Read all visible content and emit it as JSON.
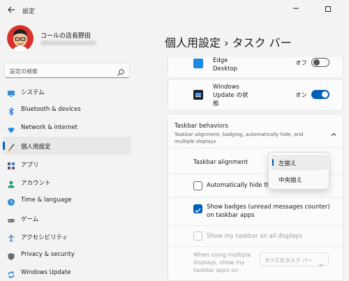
{
  "window": {
    "title": "設定",
    "back_icon": "back-arrow-icon",
    "minimize_icon": "minimize-icon",
    "maximize_icon": "maximize-icon"
  },
  "profile": {
    "name": "コールの店長野田",
    "avatar_icon": "avatar-icon"
  },
  "search": {
    "placeholder": "設定の検索",
    "icon": "search-icon"
  },
  "sidebar": {
    "items": [
      {
        "label": "システム",
        "icon": "monitor-icon",
        "active": false
      },
      {
        "label": "Bluetooth & devices",
        "icon": "bluetooth-icon",
        "active": false
      },
      {
        "label": "Network & internet",
        "icon": "wifi-icon",
        "active": false
      },
      {
        "label": "個人用設定",
        "icon": "brush-icon",
        "active": true
      },
      {
        "label": "アプリ",
        "icon": "apps-icon",
        "active": false
      },
      {
        "label": "アカウント",
        "icon": "person-icon",
        "active": false
      },
      {
        "label": "Time & language",
        "icon": "globe-clock-icon",
        "active": false
      },
      {
        "label": "ゲーム",
        "icon": "gamepad-icon",
        "active": false
      },
      {
        "label": "アクセシビリティ",
        "icon": "accessibility-icon",
        "active": false
      },
      {
        "label": "Privacy & security",
        "icon": "shield-icon",
        "active": false
      },
      {
        "label": "Windows Update",
        "icon": "windows-update-icon",
        "active": false
      }
    ]
  },
  "main": {
    "title": "個人用設定  ›  タスク バー",
    "edge_item": {
      "name": "Edge\nDesktop",
      "toggle_label": "オフ",
      "toggle_on": false,
      "icon_color": "#1e88e5"
    },
    "wu_item": {
      "name": "Windows\nUpdate の状\n態",
      "toggle_label": "オン",
      "toggle_on": true
    },
    "behaviors": {
      "title": "Taskbar behaviors",
      "description": "Taskbar alignment, badging, automatically hide, and multiple displays",
      "alignment_label": "Taskbar alignment",
      "auto_hide_label": "Automatically hide the",
      "auto_hide_checked": false,
      "badges_label": "Show badges (unread messages counter)\non taskbar apps",
      "badges_checked": true,
      "all_displays_label": "Show my taskbar on all displays",
      "all_displays_enabled": false,
      "multi_label": "When using multiple displays, show my taskbar apps on",
      "multi_value": "すべてのタスク バー"
    },
    "alignment_dropdown": {
      "options": [
        "左揃え",
        "中央揃え"
      ],
      "selected": "左揃え"
    }
  },
  "colors": {
    "accent": "#005fb8",
    "background": "#f3f3f3",
    "card": "#fbfbfb"
  }
}
